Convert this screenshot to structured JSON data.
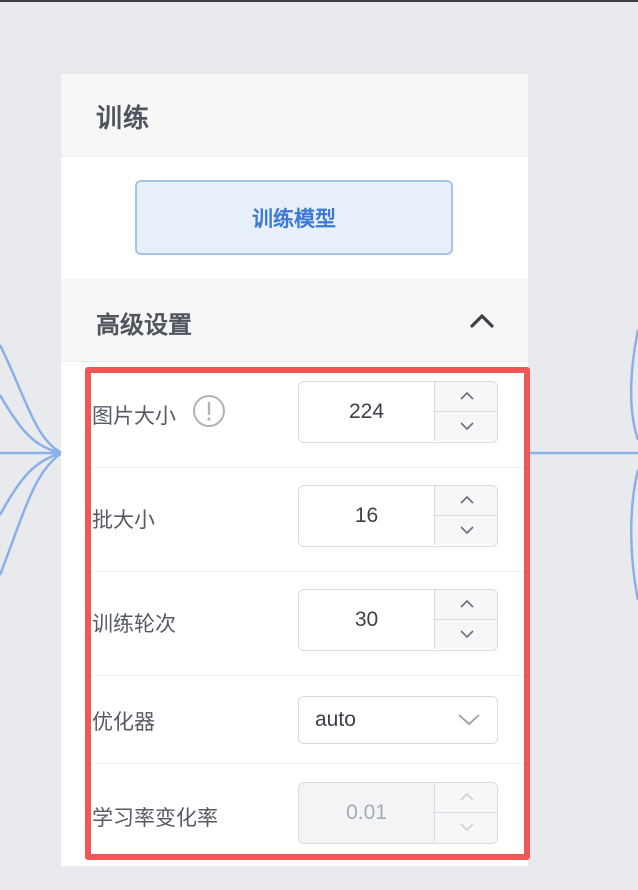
{
  "panel": {
    "title": "训练",
    "train_button_label": "训练模型",
    "advanced_title": "高级设置"
  },
  "fields": {
    "image_size": {
      "label": "图片大小",
      "value": "224"
    },
    "batch_size": {
      "label": "批大小",
      "value": "16"
    },
    "epochs": {
      "label": "训练轮次",
      "value": "30"
    },
    "optimizer": {
      "label": "优化器",
      "value": "auto"
    },
    "lr_change": {
      "label": "学习率变化率",
      "value": "0.01",
      "disabled": true
    }
  },
  "colors": {
    "accent": "#3d79d6",
    "button_bg": "#e8f0fc",
    "highlight": "#f25656",
    "connector": "#8ab0e8"
  },
  "icons": {
    "info": "info-icon",
    "collapse": "chevron-up-icon",
    "stepper_up": "chevron-up-icon",
    "stepper_down": "chevron-down-icon",
    "select_arrow": "chevron-down-icon"
  }
}
